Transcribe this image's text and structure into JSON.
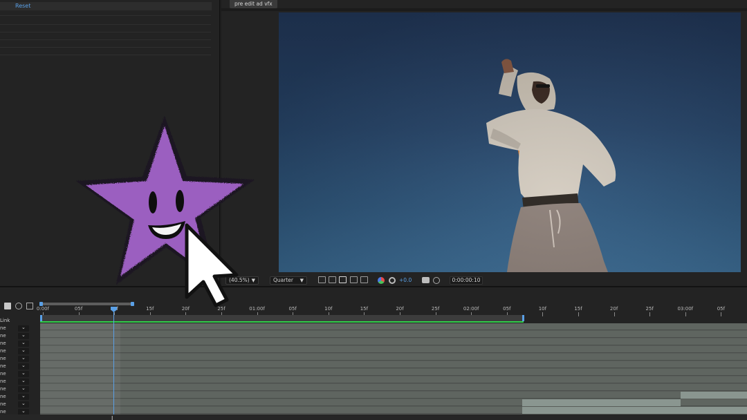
{
  "effects_panel": {
    "reset_label": "Reset"
  },
  "viewer": {
    "comp_tab": "pre edit ad vfx",
    "zoom": "(40.5%)",
    "resolution": "Quarter",
    "exposure": "+0.0",
    "timecode": "0:00:00:10",
    "sky_color": "#2a4a70"
  },
  "timeline": {
    "ruler_labels": [
      "0:00f",
      "05f",
      "10f",
      "15f",
      "20f",
      "25f",
      "01:00f",
      "05f",
      "10f",
      "15f",
      "20f",
      "25f",
      "02:00f",
      "05f",
      "10f",
      "15f",
      "20f",
      "25f",
      "03:00f",
      "05f"
    ],
    "link_label": "Link",
    "mode_rows": [
      "ne",
      "ne",
      "ne",
      "ne",
      "ne",
      "ne",
      "ne",
      "ne",
      "ne",
      "ne",
      "ne",
      "ne"
    ],
    "accent": "#5aa0e6",
    "work_area_color": "#31d04a"
  },
  "overlays": {
    "star_color": "#9b5fc0",
    "cursor": "arrow-cursor"
  }
}
